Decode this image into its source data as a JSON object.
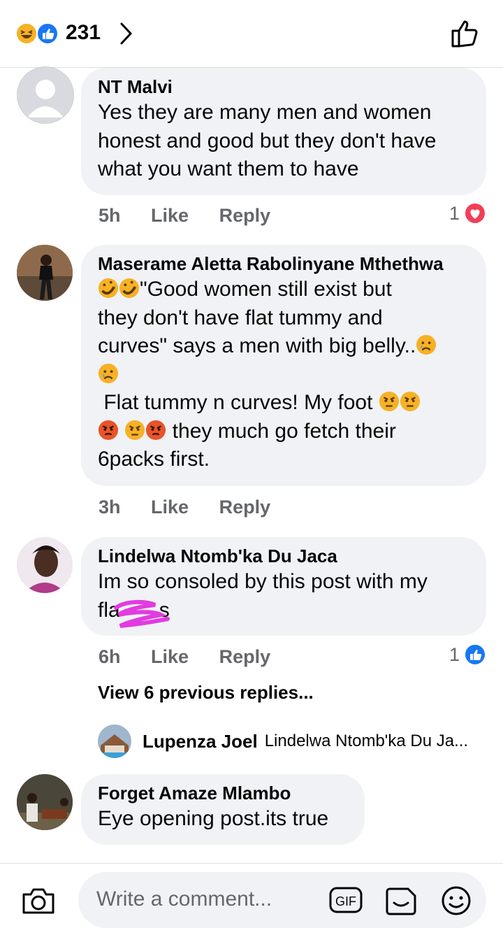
{
  "header": {
    "reaction_count": "231",
    "icons": [
      "laugh-emoji-icon",
      "like-reaction-icon",
      "chevron-right-icon",
      "thumbs-up-outline-icon"
    ]
  },
  "comments": [
    {
      "author": "NT Malvi",
      "text": "Yes they are many men and women honest and good but they don't have what you want them to have",
      "time": "5h",
      "like": "Like",
      "reply": "Reply",
      "reaction_count": "1",
      "reaction": "love"
    },
    {
      "author": "Maserame Aletta Rabolinyane Mthethwa",
      "lines": [
        "\"Good women still exist but",
        "they don't have flat tummy and",
        "curves\" says a men with big  belly..",
        "",
        " Flat tummy n curves! My foot ",
        " they much go fetch their",
        "6packs first."
      ],
      "time": "3h",
      "like": "Like",
      "reply": "Reply"
    },
    {
      "author": "Lindelwa Ntomb'ka Du Jaca",
      "line1": "Im so consoled by this post with my",
      "line2_start": "fla",
      "line2_end": "s",
      "time": "6h",
      "like": "Like",
      "reply": "Reply",
      "reaction_count": "1",
      "reaction": "like",
      "view_replies": "View 6 previous replies...",
      "reply_preview": {
        "author": "Lupenza Joel",
        "snippet": "Lindelwa Ntomb'ka Du Ja..."
      }
    },
    {
      "author": "Forget Amaze Mlambo",
      "text": "Eye opening post.its true"
    }
  ],
  "composer": {
    "placeholder": "Write a comment...",
    "gif_label": "GIF",
    "icons": [
      "camera-icon",
      "gif-icon",
      "sticker-icon",
      "emoji-icon"
    ]
  },
  "colors": {
    "accent": "#1877f2",
    "love": "#f33e58",
    "bubble": "#f0f2f5",
    "meta": "#65676b"
  }
}
